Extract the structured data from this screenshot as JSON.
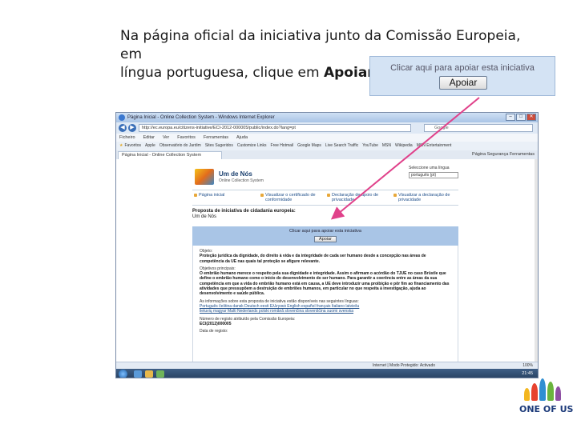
{
  "slide": {
    "title_line1": "Na página oficial da iniciativa junto da Comissão Europeia, em",
    "title_line2_prefix": "língua portuguesa, clique em ",
    "title_line2_bold": "Apoiar"
  },
  "callout": {
    "text": "Clicar aqui para apoiar esta iniciativa",
    "button": "Apoiar"
  },
  "browser": {
    "window_title": "Página Inicial - Online Collection System - Windows Internet Explorer",
    "url": "http://ec.europa.eu/citizens-initiative/ECI-2012-000005/public/index.do?lang=pt",
    "search_placeholder": "Google",
    "menu": [
      "Ficheiro",
      "Editar",
      "Ver",
      "Favoritos",
      "Ferramentas",
      "Ajuda"
    ],
    "favorites": [
      "Favoritos",
      "Apple",
      "Observatório do Jardim",
      "Sites Sugeridos",
      "Customize Links",
      "Free Hotmail",
      "Google Maps",
      "Live Search Traffic",
      "YouTube",
      "MSN",
      "Wikipedia",
      "MSN Entertainment"
    ],
    "tab_label": "Página Inicial - Online Collection System",
    "tab_tools": "Página  Segurança  Ferramentas",
    "status_zone": "Internet | Modo Protegido: Activado",
    "zoom": "100%",
    "clock": "21:45"
  },
  "site": {
    "name": "Um de Nós",
    "subtitle": "Online Collection System",
    "lang_label": "Seleccione uma língua",
    "lang_value": "português (pt)",
    "nav": [
      "Página inicial",
      "Visualizar o certificado de conformidade",
      "Declaração de apoio de privacidade",
      "Visualizar a declaração de privacidade"
    ],
    "proposal_title": "Proposta de iniciativa de cidadania europeia:",
    "proposal_name": "Um de Nós",
    "bar_text": "Clicar aqui para apoiar esta iniciativa",
    "bar_button": "Apoiar",
    "objeto_label": "Objeto:",
    "objeto_text": "Proteção jurídica da dignidade, do direito à vida e da integridade de cada ser humano desde a concepção nas áreas de competência da UE nas quais tal proteção se afigure relevante.",
    "objetivos_label": "Objetivos principais:",
    "objetivos_text": "O embrião humano merece o respeito pela sua dignidade e integridade. Assim o afirmam o acórdão do TJUE no caso Brüstle que define o embrião humano como o início do desenvolvimento do ser humano. Para garantir a coerência entre as áreas da sua competência em que a vida do embrião humano está em causa, a UE deve introduzir uma proibição e pôr fim ao financiamento das atividades que pressupõem a destruição de embriões humanos, em particular no que respeita à investigação, ajuda ao desenvolvimento e saúde pública.",
    "langs_label": "As informações sobre esta proposta de iniciativa estão disponíveis nas seguintes línguas:",
    "langs_line1": "Português  čeština  dansk  Deutsch  eesti  Ελληνικά  English  español  français  Italiano  latviešu",
    "langs_line2": "lietuvių  magyar  Malti  Nederlands  polski  română  slovenčina  slovenščina  suomi  svenska",
    "registo_label": "Número de registo atribuído pela Comissão Europeia:",
    "registo_value": "ECI(2012)000005",
    "data_label": "Data de registo:"
  },
  "logo": {
    "text": "ONE OF US"
  },
  "colors": {
    "arrow": "#e0418a",
    "callout_bg": "#d4e3f4",
    "site_bar": "#a9c5e6"
  }
}
